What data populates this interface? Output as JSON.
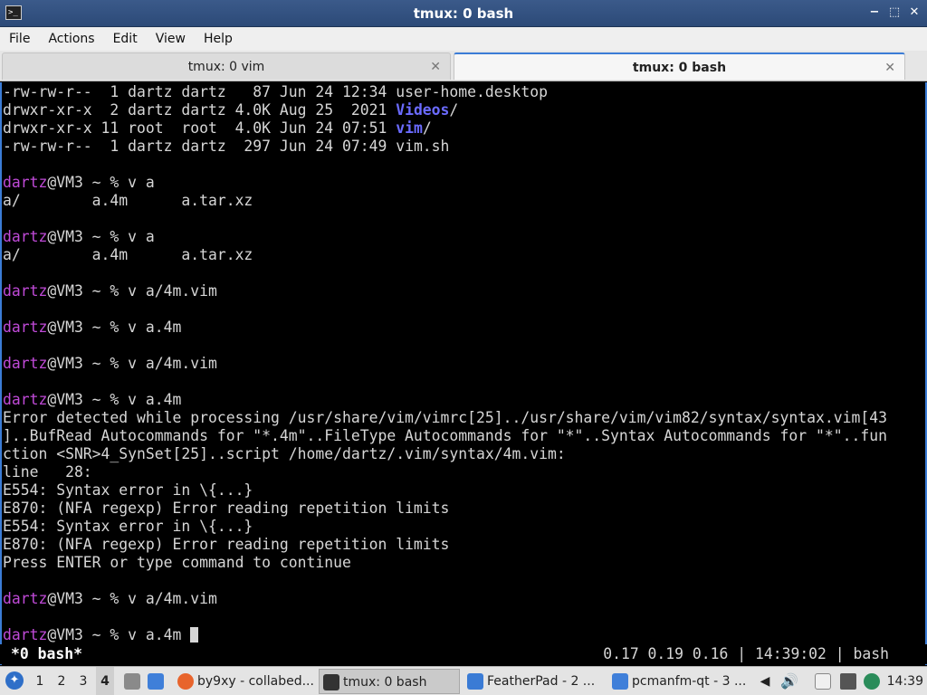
{
  "window": {
    "title": "tmux: 0 bash",
    "app_icon": ">_",
    "controls": {
      "minimize": "−",
      "maximize": "⬚",
      "close": "✕"
    }
  },
  "menubar": {
    "items": [
      "File",
      "Actions",
      "Edit",
      "View",
      "Help"
    ]
  },
  "tabs": [
    {
      "label": "tmux: 0 vim",
      "close": "✕",
      "active": false
    },
    {
      "label": "tmux: 0 bash",
      "close": "✕",
      "active": true
    }
  ],
  "terminal": {
    "listing": [
      {
        "perm": "-rw-rw-r--  1 dartz dartz   87 Jun 24 12:34 ",
        "name": "user-home.desktop",
        "suffix": "",
        "dir": false
      },
      {
        "perm": "drwxr-xr-x  2 dartz dartz 4.0K Aug 25  2021 ",
        "name": "Videos",
        "suffix": "/",
        "dir": true
      },
      {
        "perm": "drwxr-xr-x 11 root  root  4.0K Jun 24 07:51 ",
        "name": "vim",
        "suffix": "/",
        "dir": true
      },
      {
        "perm": "-rw-rw-r--  1 dartz dartz  297 Jun 24 07:49 ",
        "name": "vim.sh",
        "suffix": "",
        "dir": false
      }
    ],
    "prompt_user": "dartz",
    "prompt_rest": "@VM3 ~ % ",
    "commands": [
      "v a",
      "v a",
      "v a/4m.vim",
      "v a.4m",
      "v a/4m.vim",
      "v a.4m",
      "v a/4m.vim",
      "v a.4m "
    ],
    "completions": "a/        a.4m      a.tar.xz",
    "errors": [
      "Error detected while processing /usr/share/vim/vimrc[25]../usr/share/vim/vim82/syntax/syntax.vim[43",
      "]..BufRead Autocommands for \"*.4m\"..FileType Autocommands for \"*\"..Syntax Autocommands for \"*\"..fun",
      "ction <SNR>4_SynSet[25]..script /home/dartz/.vim/syntax/4m.vim:",
      "line   28:",
      "E554: Syntax error in \\{...}",
      "E870: (NFA regexp) Error reading repetition limits",
      "E554: Syntax error in \\{...}",
      "E870: (NFA regexp) Error reading repetition limits",
      "Press ENTER or type command to continue"
    ]
  },
  "tmux_status": {
    "window": "*0 bash*",
    "right": "0.17 0.19 0.16 | 14:39:02 | bash"
  },
  "taskbar": {
    "workspaces": [
      "1",
      "2",
      "3",
      "4"
    ],
    "active_workspace": "4",
    "tasks": [
      {
        "label": "by9xy - collabed...",
        "icon": "firefox-icon",
        "color": "#e8642c"
      },
      {
        "label": "tmux: 0 bash",
        "icon": "terminal-icon",
        "color": "#333333"
      },
      {
        "label": "FeatherPad - 2 ...",
        "icon": "featherpad-icon",
        "color": "#3a7bd5"
      },
      {
        "label": "pcmanfm-qt - 3 ...",
        "icon": "folder-icon",
        "color": "#3f7fd9"
      }
    ],
    "clock": "14:39"
  }
}
